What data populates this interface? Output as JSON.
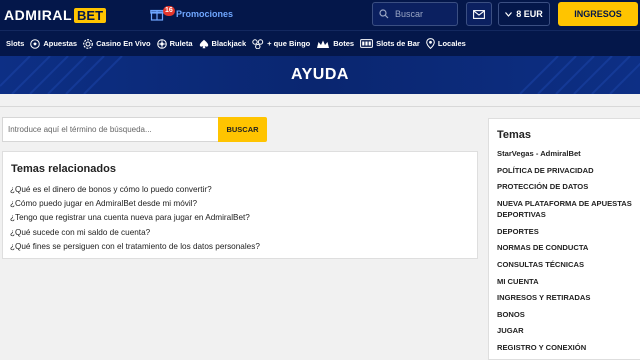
{
  "header": {
    "logo_main": "ADMIRAL",
    "logo_accent": "BET",
    "promo_count": "16",
    "promo_label": "Promociones",
    "search_placeholder": "Buscar",
    "balance": "8 EUR",
    "login_label": "INGRESOS"
  },
  "nav": {
    "items": [
      {
        "label": "Slots",
        "icon": "none"
      },
      {
        "label": "Apuestas",
        "icon": "soccer-ball-icon"
      },
      {
        "label": "Casino En Vivo",
        "icon": "chip-icon"
      },
      {
        "label": "Ruleta",
        "icon": "roulette-icon"
      },
      {
        "label": "Blackjack",
        "icon": "spade-icon"
      },
      {
        "label": "+ que Bingo",
        "icon": "bingo-icon"
      },
      {
        "label": "Botes",
        "icon": "jackpot-icon"
      },
      {
        "label": "Slots de Bar",
        "icon": "slot-machine-icon"
      },
      {
        "label": "Locales",
        "icon": "location-pin-icon"
      }
    ]
  },
  "hero": {
    "title": "AYUDA"
  },
  "search": {
    "placeholder": "Introduce aquí el término de búsqueda...",
    "button_label": "BUSCAR"
  },
  "related": {
    "title": "Temas relacionados",
    "items": [
      "¿Qué es el dinero de bonos y cómo lo puedo convertir?",
      "¿Cómo puedo jugar en AdmiralBet desde mi móvil?",
      "¿Tengo que registrar una cuenta nueva para jugar en AdmiralBet?",
      "¿Qué sucede con mi saldo de cuenta?",
      "¿Qué fines se persiguen con el tratamiento de los datos personales?"
    ]
  },
  "sidebar": {
    "title": "Temas",
    "items": [
      "StarVegas - AdmiralBet",
      "POLÍTICA DE PRIVACIDAD",
      "PROTECCIÓN DE DATOS",
      "NUEVA PLATAFORMA DE APUESTAS DEPORTIVAS",
      "DEPORTES",
      "NORMAS DE CONDUCTA",
      "CONSULTAS TÉCNICAS",
      "MI CUENTA",
      "INGRESOS Y RETIRADAS",
      "BONOS",
      "JUGAR",
      "REGISTRO Y CONEXIÓN"
    ]
  },
  "colors": {
    "navy": "#04174a",
    "accent": "#ffc400",
    "hero": "#0a2670"
  }
}
